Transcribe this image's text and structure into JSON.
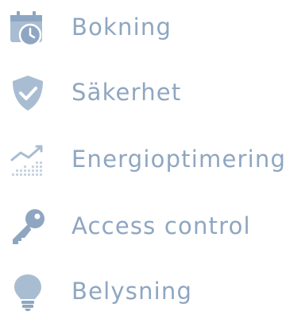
{
  "colors": {
    "label": "#8ea6c1",
    "icon": "#a9bdd2",
    "icon_dark": "#6f88a6",
    "icon_light": "#ffffff"
  },
  "features": [
    {
      "label": "Bokning",
      "icon": "calendar-clock-icon"
    },
    {
      "label": "Säkerhet",
      "icon": "shield-check-icon"
    },
    {
      "label": "Energioptimering",
      "icon": "trend-chart-icon"
    },
    {
      "label": "Access control",
      "icon": "key-icon"
    },
    {
      "label": "Belysning",
      "icon": "lightbulb-icon"
    }
  ]
}
